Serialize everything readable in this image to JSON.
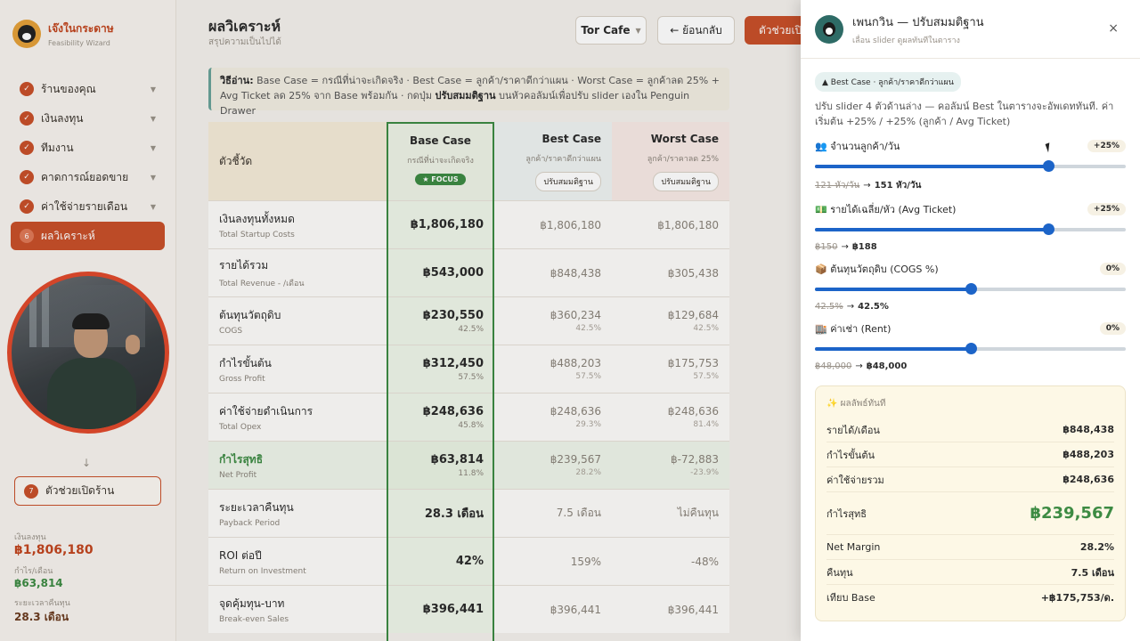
{
  "brand": {
    "title": "เจ๊งในกระดาษ",
    "subtitle": "Feasibility Wizard"
  },
  "nav": [
    {
      "label": "ร้านของคุณ",
      "icon": "check-icon"
    },
    {
      "label": "เงินลงทุน",
      "icon": "check-icon"
    },
    {
      "label": "ทีมงาน",
      "icon": "check-icon"
    },
    {
      "label": "คาดการณ์ยอดขาย",
      "icon": "check-icon"
    },
    {
      "label": "ค่าใช้จ่ายรายเดือน",
      "icon": "check-icon"
    }
  ],
  "nav_active": {
    "num": "6",
    "label": "ผลวิเคราะห์"
  },
  "arrow": "↓",
  "helper_btn": {
    "num": "7",
    "label": "ตัวช่วยเปิดร้าน"
  },
  "stats": [
    {
      "k": "เงินลงทุน",
      "v": "฿1,806,180"
    },
    {
      "k": "กำไร/เดือน",
      "v": "฿63,814"
    },
    {
      "k": "ระยะเวลาคืนทุน",
      "v": "28.3 เดือน"
    }
  ],
  "header": {
    "title": "ผลวิเคราะห์",
    "subtitle": "สรุปความเป็นไปได้",
    "store": "Tor Cafe",
    "back": "← ย้อนกลับ",
    "helper": "ตัวช่วยเปิดร้าน"
  },
  "hint": {
    "label": "วิธีอ่าน:",
    "text": " Base Case = กรณีที่น่าจะเกิดจริง · Best Case = ลูกค้า/ราคาดีกว่าแผน · Worst Case = ลูกค้าลด 25% + Avg Ticket ลด 25% จาก Base พร้อมกัน · กดปุ่ม ",
    "action": "ปรับสมมติฐาน",
    "tail": " บนหัวคอลัมน์เพื่อปรับ slider เองใน Penguin Drawer"
  },
  "table": {
    "metric_header": "ตัวชี้วัด",
    "base": {
      "title": "Base Case",
      "sub": "กรณีที่น่าจะเกิดจริง",
      "badge": "★ FOCUS"
    },
    "best": {
      "title": "Best Case",
      "sub": "ลูกค้า/ราคาดีกว่าแผน",
      "btn": "ปรับสมมติฐาน"
    },
    "worst": {
      "title": "Worst Case",
      "sub": "ลูกค้า/ราคาลด 25%",
      "btn": "ปรับสมมติฐาน"
    },
    "rows": [
      {
        "name": "เงินลงทุนทั้งหมด",
        "en": "Total Startup Costs",
        "base": "฿1,806,180",
        "base_p": "",
        "best": "฿1,806,180",
        "best_p": "",
        "worst": "฿1,806,180",
        "worst_p": ""
      },
      {
        "name": "รายได้รวม",
        "en": "Total Revenue - /เดือน",
        "base": "฿543,000",
        "base_p": "",
        "best": "฿848,438",
        "best_p": "",
        "worst": "฿305,438",
        "worst_p": ""
      },
      {
        "name": "ต้นทุนวัตถุดิบ",
        "en": "COGS",
        "base": "฿230,550",
        "base_p": "42.5%",
        "best": "฿360,234",
        "best_p": "42.5%",
        "worst": "฿129,684",
        "worst_p": "42.5%"
      },
      {
        "name": "กำไรขั้นต้น",
        "en": "Gross Profit",
        "base": "฿312,450",
        "base_p": "57.5%",
        "best": "฿488,203",
        "best_p": "57.5%",
        "worst": "฿175,753",
        "worst_p": "57.5%"
      },
      {
        "name": "ค่าใช้จ่ายดำเนินการ",
        "en": "Total Opex",
        "base": "฿248,636",
        "base_p": "45.8%",
        "best": "฿248,636",
        "best_p": "29.3%",
        "worst": "฿248,636",
        "worst_p": "81.4%"
      },
      {
        "name": "กำไรสุทธิ",
        "en": "Net Profit",
        "base": "฿63,814",
        "base_p": "11.8%",
        "best": "฿239,567",
        "best_p": "28.2%",
        "worst": "฿-72,883",
        "worst_p": "-23.9%"
      },
      {
        "name": "ระยะเวลาคืนทุน",
        "en": "Payback Period",
        "base": "28.3 เดือน",
        "base_p": "",
        "best": "7.5 เดือน",
        "best_p": "",
        "worst": "ไม่คืนทุน",
        "worst_p": ""
      },
      {
        "name": "ROI ต่อปี",
        "en": "Return on Investment",
        "base": "42%",
        "base_p": "",
        "best": "159%",
        "best_p": "",
        "worst": "-48%",
        "worst_p": ""
      },
      {
        "name": "จุดคุ้มทุน-บาท",
        "en": "Break-even Sales",
        "base": "฿396,441",
        "base_p": "",
        "best": "฿396,441",
        "best_p": "",
        "worst": "฿396,441",
        "worst_p": ""
      }
    ]
  },
  "drawer": {
    "title": "เพนกวิน — ปรับสมมติฐาน",
    "subtitle": "เลื่อน slider ดูผลทันทีในตาราง",
    "close": "×",
    "chip": "▲ Best Case · ลูกค้า/ราคาดีกว่าแผน",
    "intro": "ปรับ slider 4 ตัวด้านล่าง — คอลัมน์ Best ในตารางจะอัพเดททันที. ค่าเริ่มต้น +25% / +25% (ลูกค้า / Avg Ticket)",
    "sliders": [
      {
        "label": "👥 จำนวนลูกค้า/วัน",
        "pct": "+25%",
        "level": 0.75,
        "old": "121 หัว/วัน",
        "new": "151 หัว/วัน"
      },
      {
        "label": "💵 รายได้เฉลี่ย/หัว (Avg Ticket)",
        "pct": "+25%",
        "level": 0.75,
        "old": "฿150",
        "new": "฿188"
      },
      {
        "label": "📦 ต้นทุนวัตถุดิบ (COGS %)",
        "pct": "0%",
        "level": 0.5,
        "old": "42.5%",
        "new": "42.5%"
      },
      {
        "label": "🏬 ค่าเช่า (Rent)",
        "pct": "0%",
        "level": 0.5,
        "old": "฿48,000",
        "new": "฿48,000"
      }
    ],
    "arrow": "→",
    "result": {
      "title": "✨ ผลลัพธ์ทันที",
      "rows": [
        {
          "k": "รายได้/เดือน",
          "v": "฿848,438"
        },
        {
          "k": "กำไรขั้นต้น",
          "v": "฿488,203"
        },
        {
          "k": "ค่าใช้จ่ายรวม",
          "v": "฿248,636"
        },
        {
          "k": "กำไรสุทธิ",
          "v": "฿239,567",
          "big": true
        },
        {
          "k": "Net Margin",
          "v": "28.2%"
        },
        {
          "k": "คืนทุน",
          "v": "7.5 เดือน"
        },
        {
          "k": "เทียบ Base",
          "v": "+฿175,753/ด."
        }
      ]
    }
  },
  "colors": {
    "accent": "#c8502a",
    "success": "#3d8b43",
    "slider": "#1c64c8"
  }
}
